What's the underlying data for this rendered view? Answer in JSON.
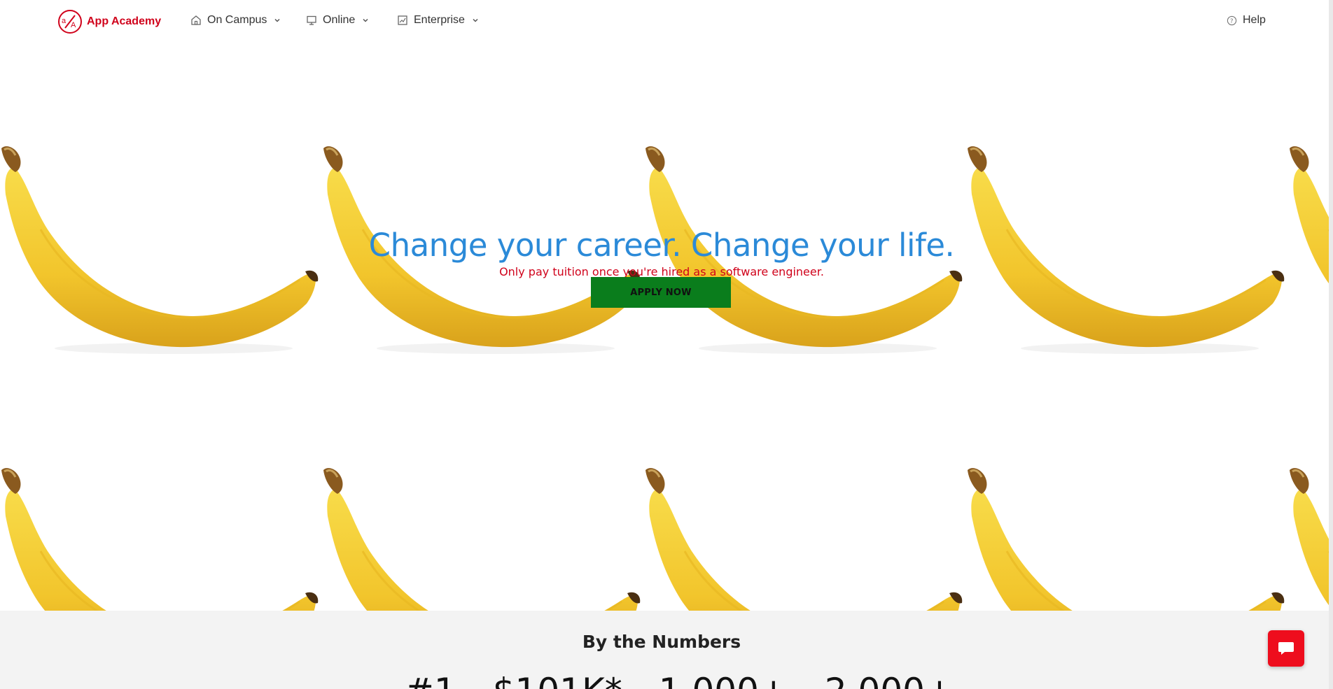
{
  "header": {
    "brand": "App Academy",
    "nav": [
      {
        "label": "On Campus",
        "icon": "home-icon"
      },
      {
        "label": "Online",
        "icon": "monitor-icon"
      },
      {
        "label": "Enterprise",
        "icon": "chart-icon"
      }
    ],
    "help_label": "Help"
  },
  "hero": {
    "title": "Change your career. Change your life.",
    "subtitle": "Only pay tuition once you're hired as a software engineer.",
    "cta_label": "APPLY NOW"
  },
  "numbers": {
    "title": "By the Numbers",
    "stats": [
      "#1",
      "$101K*",
      "1,000+",
      "2,000+"
    ]
  },
  "colors": {
    "brand": "#d0021b",
    "title_blue": "#2b8ad8",
    "cta_green": "#0a7d1c",
    "chat_red": "#ee0d1d"
  }
}
